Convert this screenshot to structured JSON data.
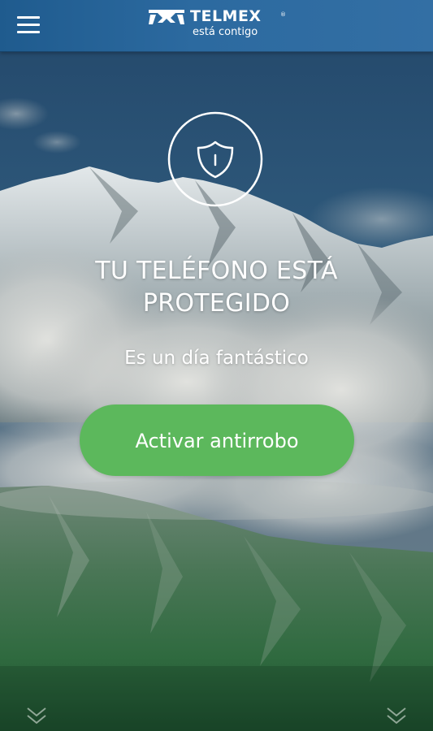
{
  "app_bar": {
    "menu_icon": "hamburger-menu-icon",
    "brand_logo": "telmex-logo-icon",
    "brand_name": "TELMEX",
    "brand_registered": "®",
    "brand_tagline": "está contigo",
    "colors": {
      "bar_gradient_start": "#1f5b8e",
      "bar_gradient_end": "#336fa4"
    }
  },
  "protection": {
    "status_icon": "shield-icon",
    "status_title": "TU TELÉFONO ESTÁ PROTEGIDO",
    "greeting": "Es un día fantástico",
    "activate_button_label": "Activar antirrobo",
    "colors": {
      "button": "#5cb85c",
      "text": "#ffffff"
    }
  },
  "footer": {
    "left_icon": "double-chevron-down-icon",
    "right_icon": "double-chevron-down-icon"
  }
}
